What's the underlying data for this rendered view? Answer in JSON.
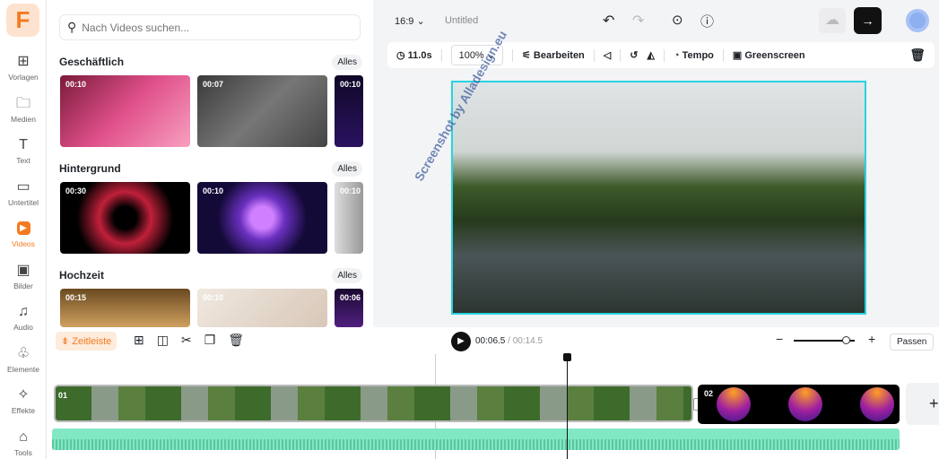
{
  "app": {
    "logo": "F",
    "accent": "#f47a20"
  },
  "sidebar": {
    "items": [
      {
        "label": "Vorlagen",
        "icon": "layout-icon",
        "glyph": "⊞"
      },
      {
        "label": "Medien",
        "icon": "folder-plus-icon",
        "glyph": "🗀"
      },
      {
        "label": "Text",
        "icon": "text-icon",
        "glyph": "T"
      },
      {
        "label": "Untertitel",
        "icon": "subtitle-icon",
        "glyph": "▭"
      },
      {
        "label": "Videos",
        "icon": "video-icon",
        "glyph": "▶",
        "active": true
      },
      {
        "label": "Bilder",
        "icon": "image-icon",
        "glyph": "▣"
      },
      {
        "label": "Audio",
        "icon": "music-icon",
        "glyph": "♫"
      },
      {
        "label": "Elemente",
        "icon": "shapes-icon",
        "glyph": "♧"
      },
      {
        "label": "Effekte",
        "icon": "sparkle-icon",
        "glyph": "✧"
      },
      {
        "label": "Tools",
        "icon": "toolbox-icon",
        "glyph": "⌂"
      }
    ]
  },
  "panel": {
    "search_placeholder": "Nach Videos suchen...",
    "all_label": "Alles",
    "categories": [
      {
        "title": "Geschäftlich",
        "thumbs": [
          "00:10",
          "00:07",
          "00:10"
        ]
      },
      {
        "title": "Hintergrund",
        "thumbs": [
          "00:30",
          "00:10",
          "00:10"
        ]
      },
      {
        "title": "Hochzeit",
        "thumbs": [
          "00:15",
          "00:10",
          "00:06"
        ]
      }
    ]
  },
  "topbar": {
    "aspect": "16:9",
    "title": "Untitled"
  },
  "toolbar": {
    "duration": "11.0s",
    "zoom": "100%",
    "edit": "Bearbeiten",
    "speed": "Tempo",
    "greenscreen": "Greenscreen"
  },
  "watermark": "Screenshot by Alladesign.eu",
  "timeline": {
    "label": "Zeitleiste",
    "current": "00:06.5",
    "total": "/ 00:14.5",
    "fit": "Passen",
    "zoom_level": 0.85,
    "clips": [
      "01",
      "02"
    ]
  }
}
